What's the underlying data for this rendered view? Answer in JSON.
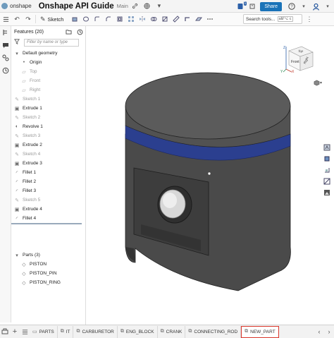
{
  "topbar": {
    "brand": "onshape",
    "doc_title": "Onshape API Guide",
    "branch": "Main",
    "share_label": "Share",
    "notification_count": "1"
  },
  "toolbar": {
    "sketch_label": "Sketch",
    "search_label": "Search tools...",
    "search_shortcut": "alt/⌥ c"
  },
  "features": {
    "header": "Features (20)",
    "filter_placeholder": "Filter by name or type",
    "items": [
      {
        "label": "Default geometry",
        "icon": "chevron-down-icon",
        "muted": false,
        "indent": 0
      },
      {
        "label": "Origin",
        "icon": "origin-icon",
        "muted": false,
        "indent": 1
      },
      {
        "label": "Top",
        "icon": "plane-icon",
        "muted": true,
        "indent": 1
      },
      {
        "label": "Front",
        "icon": "plane-icon",
        "muted": true,
        "indent": 1
      },
      {
        "label": "Right",
        "icon": "plane-icon",
        "muted": true,
        "indent": 1
      },
      {
        "label": "Sketch 1",
        "icon": "sketch-icon",
        "muted": true,
        "indent": 0
      },
      {
        "label": "Extrude 1",
        "icon": "extrude-icon",
        "muted": false,
        "indent": 0
      },
      {
        "label": "Sketch 2",
        "icon": "sketch-icon",
        "muted": true,
        "indent": 0
      },
      {
        "label": "Revolve 1",
        "icon": "revolve-icon",
        "muted": false,
        "indent": 0
      },
      {
        "label": "Sketch 3",
        "icon": "sketch-icon",
        "muted": true,
        "indent": 0
      },
      {
        "label": "Extrude 2",
        "icon": "extrude-icon",
        "muted": false,
        "indent": 0
      },
      {
        "label": "Sketch 4",
        "icon": "sketch-icon",
        "muted": true,
        "indent": 0
      },
      {
        "label": "Extrude 3",
        "icon": "extrude-icon",
        "muted": false,
        "indent": 0
      },
      {
        "label": "Fillet 1",
        "icon": "fillet-icon",
        "muted": false,
        "indent": 0
      },
      {
        "label": "Fillet 2",
        "icon": "fillet-icon",
        "muted": false,
        "indent": 0
      },
      {
        "label": "Fillet 3",
        "icon": "fillet-icon",
        "muted": false,
        "indent": 0
      },
      {
        "label": "Sketch 5",
        "icon": "sketch-icon",
        "muted": true,
        "indent": 0
      },
      {
        "label": "Extrude 4",
        "icon": "extrude-icon",
        "muted": false,
        "indent": 0
      },
      {
        "label": "Fillet 4",
        "icon": "fillet-icon",
        "muted": false,
        "indent": 0
      }
    ],
    "parts_header": "Parts (3)",
    "parts": [
      "PISTON",
      "PISTON_PIN",
      "PISTON_RING"
    ]
  },
  "view_cube": {
    "front": "Front",
    "top": "Top",
    "right": "Right",
    "axis_x": "X",
    "axis_y": "Y",
    "axis_z": "Z"
  },
  "bottom_tabs": [
    {
      "label": "PARTS",
      "active": false
    },
    {
      "label": "IT",
      "active": false
    },
    {
      "label": "CARBURETOR",
      "active": false
    },
    {
      "label": "ENG_BLOCK",
      "active": false
    },
    {
      "label": "CRANK",
      "active": false
    },
    {
      "label": "CONNECTING_ROD",
      "active": false
    },
    {
      "label": "NEW_PART",
      "active": true
    }
  ],
  "colors": {
    "accent": "#1a73b8",
    "active_tab_border": "#d9362b",
    "model_body": "#4d4d4d",
    "model_top": "#5a5a5a",
    "ring": "#2b3f8f"
  }
}
